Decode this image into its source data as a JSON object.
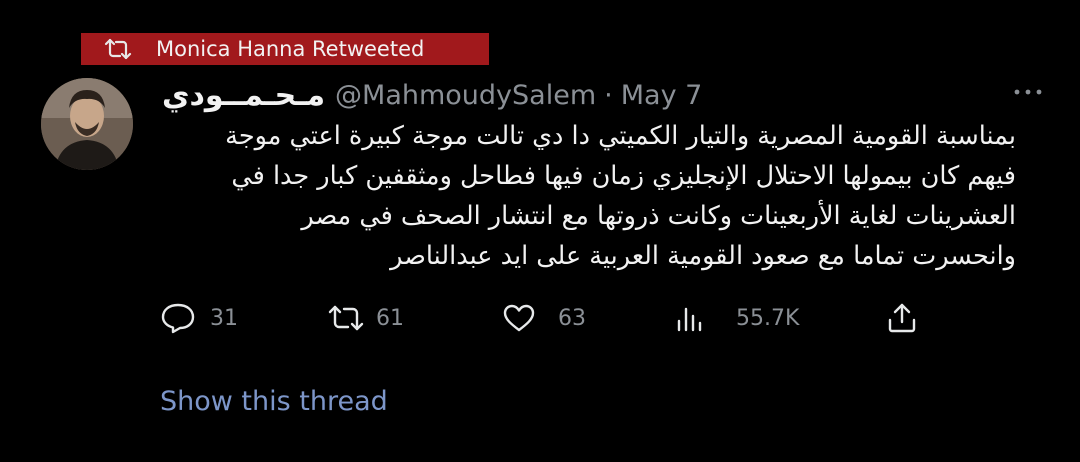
{
  "retweet_banner": {
    "text": "Monica Hanna Retweeted",
    "icon": "retweet-icon",
    "background": "#a1191c"
  },
  "tweet": {
    "display_name": "مـحـمــودي",
    "handle": "@MahmoudySalem",
    "separator": "·",
    "date": "May 7",
    "text_lines": [
      "بمناسبة القومية المصرية والتيار الكميتي دا دي تالت موجة كبيرة اعتي موجة",
      "فيهم كان بيمولها الاحتلال الإنجليزي زمان فيها فطاحل ومثقفين كبار جدا في",
      "العشرينات لغاية الأربعينات وكانت ذروتها مع انتشار الصحف في مصر",
      "وانحسرت تماما مع صعود القومية العربية على ايد عبدالناصر"
    ]
  },
  "actions": {
    "reply": {
      "icon": "reply-icon",
      "count": "31"
    },
    "retweet": {
      "icon": "retweet-icon",
      "count": "61"
    },
    "like": {
      "icon": "heart-icon",
      "count": "63"
    },
    "views": {
      "icon": "views-icon",
      "count": "55.7K"
    },
    "share": {
      "icon": "share-icon"
    }
  },
  "show_thread": "Show this thread",
  "colors": {
    "background": "#000000",
    "text": "#f2f2f2",
    "muted": "#8b9096",
    "link": "#7d96c9"
  }
}
